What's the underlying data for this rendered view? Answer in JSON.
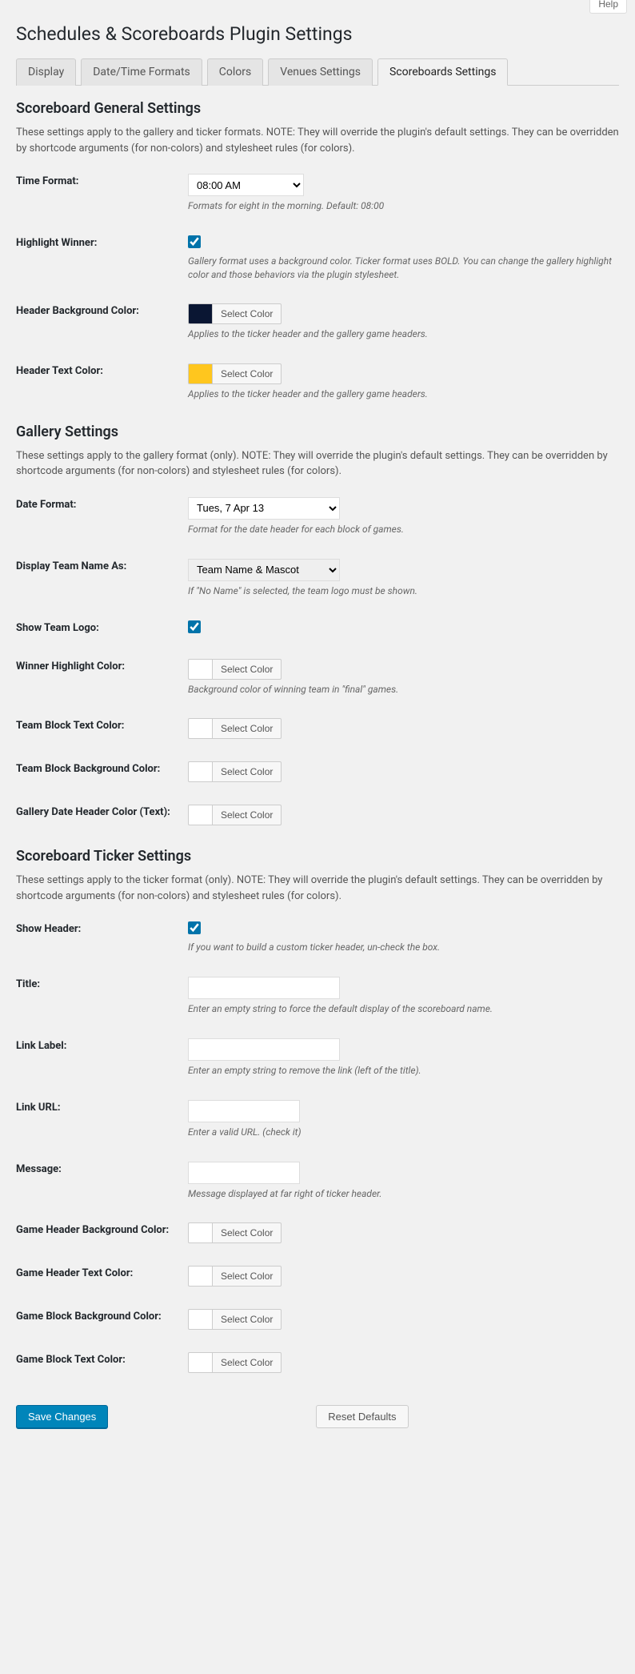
{
  "help_label": "Help",
  "page_title": "Schedules & Scoreboards Plugin Settings",
  "tabs": [
    {
      "label": "Display"
    },
    {
      "label": "Date/Time Formats"
    },
    {
      "label": "Colors"
    },
    {
      "label": "Venues Settings"
    },
    {
      "label": "Scoreboards Settings"
    }
  ],
  "sections": {
    "general": {
      "heading": "Scoreboard General Settings",
      "desc": "These settings apply to the gallery and ticker formats. NOTE: They will override the plugin's default settings. They can be overridden by shortcode arguments (for non-colors) and stylesheet rules (for colors).",
      "time_format": {
        "label": "Time Format:",
        "value": "08:00 AM",
        "hint": "Formats for eight in the morning. Default: 08:00"
      },
      "highlight_winner": {
        "label": "Highlight Winner:",
        "checked": true,
        "hint": "Gallery format uses a background color. Ticker format uses BOLD. You can change the gallery highlight color and those behaviors via the plugin stylesheet."
      },
      "header_bg": {
        "label": "Header Background Color:",
        "swatch": "#0a1633",
        "btn": "Select Color",
        "hint": "Applies to the ticker header and the gallery game headers."
      },
      "header_text": {
        "label": "Header Text Color:",
        "swatch": "#ffc61e",
        "btn": "Select Color",
        "hint": "Applies to the ticker header and the gallery game headers."
      }
    },
    "gallery": {
      "heading": "Gallery Settings",
      "desc": "These settings apply to the gallery format (only). NOTE: They will override the plugin's default settings. They can be overridden by shortcode arguments (for non-colors) and stylesheet rules (for colors).",
      "date_format": {
        "label": "Date Format:",
        "value": "Tues, 7 Apr 13",
        "hint": "Format for the date header for each block of games."
      },
      "team_name_as": {
        "label": "Display Team Name As:",
        "value": "Team Name & Mascot",
        "hint": "If \"No Name\" is selected, the team logo must be shown."
      },
      "show_logo": {
        "label": "Show Team Logo:",
        "checked": true
      },
      "winner_highlight": {
        "label": "Winner Highlight Color:",
        "swatch": "#ffffff",
        "btn": "Select Color",
        "hint": "Background color of winning team in \"final\" games."
      },
      "team_block_text": {
        "label": "Team Block Text Color:",
        "swatch": "#ffffff",
        "btn": "Select Color"
      },
      "team_block_bg": {
        "label": "Team Block Background Color:",
        "swatch": "#ffffff",
        "btn": "Select Color"
      },
      "date_header_text": {
        "label": "Gallery Date Header Color (Text):",
        "swatch": "#ffffff",
        "btn": "Select Color"
      }
    },
    "ticker": {
      "heading": "Scoreboard Ticker Settings",
      "desc": "These settings apply to the ticker format (only). NOTE: They will override the plugin's default settings. They can be overridden by shortcode arguments (for non-colors) and stylesheet rules (for colors).",
      "show_header": {
        "label": "Show Header:",
        "checked": true,
        "hint": "If you want to build a custom ticker header, un-check the box."
      },
      "title": {
        "label": "Title:",
        "value": "",
        "hint": "Enter an empty string to force the default display of the scoreboard name."
      },
      "link_label": {
        "label": "Link Label:",
        "value": "",
        "hint": "Enter an empty string to remove the link (left of the title)."
      },
      "link_url": {
        "label": "Link URL:",
        "value": "",
        "hint": "Enter a valid URL. (check it)"
      },
      "message": {
        "label": "Message:",
        "value": "",
        "hint": "Message displayed at far right of ticker header."
      },
      "game_header_bg": {
        "label": "Game Header Background Color:",
        "swatch": "#ffffff",
        "btn": "Select Color"
      },
      "game_header_text": {
        "label": "Game Header Text Color:",
        "swatch": "#ffffff",
        "btn": "Select Color"
      },
      "game_block_bg": {
        "label": "Game Block Background Color:",
        "swatch": "#ffffff",
        "btn": "Select Color"
      },
      "game_block_text": {
        "label": "Game Block Text Color:",
        "swatch": "#ffffff",
        "btn": "Select Color"
      }
    }
  },
  "footer": {
    "save": "Save Changes",
    "reset": "Reset Defaults"
  }
}
